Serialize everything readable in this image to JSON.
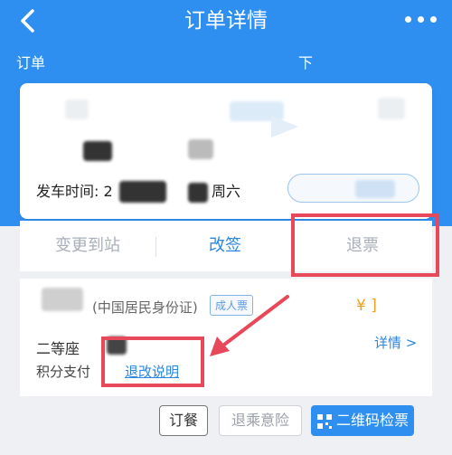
{
  "header": {
    "title": "订单详情",
    "sub_left": "订单",
    "sub_right": "下"
  },
  "trip": {
    "time_label": "发车时间: 2",
    "weekday": "周六"
  },
  "actions": {
    "change_station": "变更到站",
    "reschedule": "改签",
    "refund": "退票"
  },
  "passenger": {
    "id_type": "(中国居民身份证)",
    "ticket_type": "成人票",
    "price": "¥ ]",
    "seat": "二等座",
    "detail": "详情 >",
    "payment": "积分支付",
    "policy_link": "退改说明"
  },
  "bottom_buttons": {
    "meal": "订餐",
    "insurance": "退乘意险",
    "qr": "二维码检票"
  },
  "colors": {
    "brand_blue": "#2f8ff0",
    "highlight_red": "#e8495a",
    "price_orange": "#f0a020"
  }
}
